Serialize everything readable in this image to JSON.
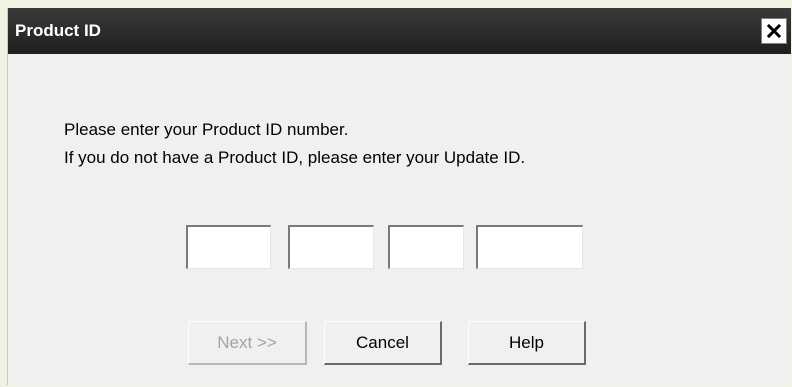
{
  "dialog": {
    "title": "Product ID",
    "close_icon": "close-icon",
    "message_line1": "Please enter your Product ID number.",
    "message_line2": "If you do not have a Product ID, please enter your Update ID.",
    "id_fields": [
      {
        "value": ""
      },
      {
        "value": ""
      },
      {
        "value": ""
      },
      {
        "value": ""
      }
    ],
    "buttons": {
      "next_label": "Next >>",
      "next_enabled": false,
      "cancel_label": "Cancel",
      "help_label": "Help"
    }
  },
  "colors": {
    "titlebar": "#2a2a2a",
    "dialog_bg": "#f0f0f0",
    "disabled_text": "#a4a4a4"
  }
}
